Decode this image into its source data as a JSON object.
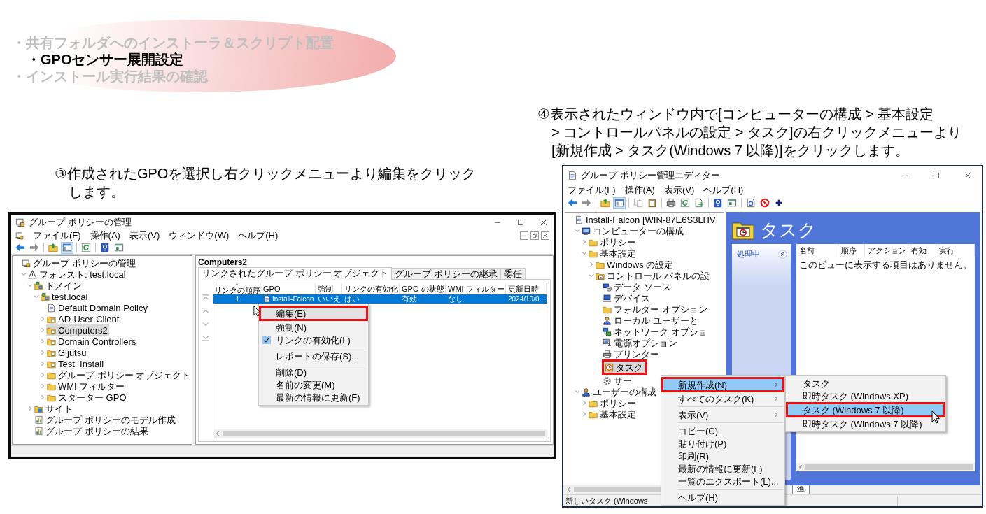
{
  "agenda": [
    {
      "label": "・共有フォルダへのインストーラ＆スクリプト配置",
      "selected": false
    },
    {
      "label": "・GPOセンサー展開設定",
      "selected": true
    },
    {
      "label": "・インストール実行結果の確認",
      "selected": false
    }
  ],
  "steps": [
    {
      "caption": [
        "③作成されたGPOを選択し右クリックメニューより編集をクリック",
        "します。"
      ],
      "window": {
        "kind": "management",
        "title": "グループ ポリシーの管理",
        "menu": [
          "ファイル(F)",
          "操作(A)",
          "表示(V)",
          "ウィンドウ(W)",
          "ヘルプ(H)"
        ],
        "toolbar": [
          [
            {
              "pressed": false,
              "disabled": false
            },
            {
              "pressed": false,
              "disabled": true
            }
          ],
          [
            {
              "pressed": false,
              "disabled": false
            },
            {
              "pressed": true,
              "disabled": false
            }
          ],
          [
            {
              "pressed": false,
              "disabled": false
            }
          ],
          [
            {
              "pressed": false,
              "disabled": false
            },
            {
              "pressed": false,
              "disabled": false
            }
          ]
        ],
        "tree": [
          {
            "label": "グループ ポリシーの管理",
            "selected": false,
            "children": [
              {
                "label": "フォレスト: test.local",
                "selected": false,
                "expanded": true,
                "children": [
                  {
                    "label": "ドメイン",
                    "selected": false,
                    "expanded": true,
                    "children": [
                      {
                        "label": "test.local",
                        "selected": false,
                        "expanded": true,
                        "children": [
                          {
                            "label": "Default Domain Policy",
                            "selected": false
                          },
                          {
                            "label": "AD-User-Client",
                            "selected": false,
                            "expanded": false
                          },
                          {
                            "label": "Computers2",
                            "selected": true,
                            "expanded": false
                          },
                          {
                            "label": "Domain Controllers",
                            "selected": false,
                            "expanded": false
                          },
                          {
                            "label": "Gijutsu",
                            "selected": false,
                            "expanded": false
                          },
                          {
                            "label": "Test_Install",
                            "selected": false,
                            "expanded": false
                          },
                          {
                            "label": "グループ ポリシー オブジェクト",
                            "selected": false,
                            "expanded": false
                          },
                          {
                            "label": "WMI フィルター",
                            "selected": false,
                            "expanded": false
                          },
                          {
                            "label": "スターター GPO",
                            "selected": false,
                            "expanded": false
                          }
                        ]
                      }
                    ]
                  },
                  {
                    "label": "サイト",
                    "selected": false,
                    "expanded": false
                  },
                  {
                    "label": "グループ ポリシーのモデル作成",
                    "selected": false
                  },
                  {
                    "label": "グループ ポリシーの結果",
                    "selected": false
                  }
                ]
              }
            ]
          }
        ],
        "detail": {
          "heading": "Computers2",
          "tabs": [
            {
              "label": "リンクされたグループ ポリシー オブジェクト",
              "selected": true
            },
            {
              "label": "グループ ポリシーの継承",
              "selected": false
            },
            {
              "label": "委任",
              "selected": false
            }
          ],
          "order_buttons": {
            "disabled": true
          },
          "columns": [
            {
              "label": "リンクの順序",
              "sorted": true
            },
            {
              "label": "GPO",
              "sorted": false
            },
            {
              "label": "強制",
              "sorted": false
            },
            {
              "label": "リンクの有効化",
              "sorted": false
            },
            {
              "label": "GPO の状態",
              "sorted": false
            },
            {
              "label": "WMI フィルター",
              "sorted": false
            },
            {
              "label": "更新日時",
              "sorted": false
            }
          ],
          "rows": [
            {
              "cells": [
                "1",
                "Install-Falcon",
                "いいえ",
                "はい",
                "有効",
                "なし",
                "2024/10/0..."
              ],
              "selected": true
            }
          ]
        },
        "context_menu": {
          "sections": [
            {
              "items": [
                {
                  "label": "編集(E)",
                  "selected": true,
                  "boxed": true,
                  "checked": false
                },
                {
                  "label": "強制(N)",
                  "selected": false,
                  "boxed": false,
                  "checked": false
                },
                {
                  "label": "リンクの有効化(L)",
                  "selected": false,
                  "boxed": false,
                  "checked": true
                }
              ]
            },
            {
              "items": [
                {
                  "label": "レポートの保存(S)...",
                  "selected": false,
                  "boxed": false,
                  "checked": false
                }
              ]
            },
            {
              "items": [
                {
                  "label": "削除(D)",
                  "selected": false,
                  "boxed": false,
                  "checked": false
                },
                {
                  "label": "名前の変更(M)",
                  "selected": false,
                  "boxed": false,
                  "checked": false
                },
                {
                  "label": "最新の情報に更新(F)",
                  "selected": false,
                  "boxed": false,
                  "checked": false
                }
              ]
            }
          ]
        }
      }
    },
    {
      "caption": [
        "④表示されたウィンドウ内で[コンピューターの構成 > 基本設定",
        "> コントロールパネルの設定 > タスク]の右クリックメニューより",
        "[新規作成 > タスク(Windows 7 以降)]をクリックします。"
      ],
      "window": {
        "kind": "editor",
        "title": "グループ ポリシー管理エディター",
        "menu": [
          "ファイル(F)",
          "操作(A)",
          "表示(V)",
          "ヘルプ(H)"
        ],
        "toolbar": [
          [
            {
              "pressed": false,
              "disabled": false
            },
            {
              "pressed": false,
              "disabled": true
            }
          ],
          [
            {
              "pressed": false,
              "disabled": false
            },
            {
              "pressed": true,
              "disabled": false
            }
          ],
          [
            {
              "pressed": false,
              "disabled": true
            },
            {
              "pressed": false,
              "disabled": false
            }
          ],
          [
            {
              "pressed": false,
              "disabled": false
            },
            {
              "pressed": false,
              "disabled": false
            },
            {
              "pressed": false,
              "disabled": false
            }
          ],
          [
            {
              "pressed": false,
              "disabled": false
            },
            {
              "pressed": false,
              "disabled": false
            }
          ],
          [
            {
              "pressed": false,
              "disabled": false
            },
            {
              "pressed": false,
              "disabled": false
            },
            {
              "pressed": false,
              "disabled": false
            }
          ]
        ],
        "tree": [
          {
            "label": "Install-Falcon [WIN-87E6S3LHV",
            "selected": false,
            "boxed": false,
            "children": [
              {
                "label": "コンピューターの構成",
                "selected": false,
                "boxed": false,
                "expanded": true,
                "children": [
                  {
                    "label": "ポリシー",
                    "selected": false,
                    "boxed": false,
                    "expanded": false
                  },
                  {
                    "label": "基本設定",
                    "selected": false,
                    "boxed": false,
                    "expanded": true,
                    "children": [
                      {
                        "label": "Windows の設定",
                        "selected": false,
                        "boxed": false,
                        "expanded": false
                      },
                      {
                        "label": "コントロール パネルの設",
                        "selected": false,
                        "boxed": false,
                        "expanded": true,
                        "children": [
                          {
                            "label": "データ ソース",
                            "selected": false,
                            "boxed": false
                          },
                          {
                            "label": "デバイス",
                            "selected": false,
                            "boxed": false
                          },
                          {
                            "label": "フォルダー オプション",
                            "selected": false,
                            "boxed": false
                          },
                          {
                            "label": "ローカル ユーザーと",
                            "selected": false,
                            "boxed": false
                          },
                          {
                            "label": "ネットワーク オプショ",
                            "selected": false,
                            "boxed": false
                          },
                          {
                            "label": "電源オプション",
                            "selected": false,
                            "boxed": false
                          },
                          {
                            "label": "プリンター",
                            "selected": false,
                            "boxed": false
                          },
                          {
                            "label": "タスク",
                            "selected": true,
                            "boxed": true
                          },
                          {
                            "label": "サー",
                            "selected": false,
                            "boxed": false
                          }
                        ]
                      }
                    ]
                  }
                ]
              },
              {
                "label": "ユーザーの構成",
                "selected": false,
                "boxed": false,
                "expanded": true,
                "children": [
                  {
                    "label": "ポリシー",
                    "selected": false,
                    "boxed": false,
                    "expanded": false
                  },
                  {
                    "label": "基本設定",
                    "selected": false,
                    "boxed": false,
                    "expanded": false
                  }
                ]
              }
            ]
          }
        ],
        "detail": {
          "title": "タスク",
          "panel_title": "処理中",
          "columns": [
            "名前",
            "順序",
            "アクション",
            "有効",
            "実行"
          ],
          "empty_message": "このビューに表示する項目はありません。"
        },
        "bottom_tabs": [
          "準"
        ],
        "status_bar": "新しいタスク (Windows",
        "context_menu": {
          "sections": [
            {
              "items": [
                {
                  "label": "新規作成(N)",
                  "selected": true,
                  "boxed": true,
                  "submenu": true
                },
                {
                  "label": "すべてのタスク(K)",
                  "selected": false,
                  "boxed": false,
                  "submenu": true
                }
              ]
            },
            {
              "items": [
                {
                  "label": "表示(V)",
                  "selected": false,
                  "boxed": false,
                  "submenu": true
                }
              ]
            },
            {
              "items": [
                {
                  "label": "コピー(C)",
                  "selected": false,
                  "boxed": false,
                  "submenu": false
                },
                {
                  "label": "貼り付け(P)",
                  "selected": false,
                  "boxed": false,
                  "submenu": false
                },
                {
                  "label": "印刷(R)",
                  "selected": false,
                  "boxed": false,
                  "submenu": false
                },
                {
                  "label": "最新の情報に更新(F)",
                  "selected": false,
                  "boxed": false,
                  "submenu": false
                },
                {
                  "label": "一覧のエクスポート(L)...",
                  "selected": false,
                  "boxed": false,
                  "submenu": false
                }
              ]
            },
            {
              "items": [
                {
                  "label": "ヘルプ(H)",
                  "selected": false,
                  "boxed": false,
                  "submenu": false
                }
              ]
            }
          ]
        },
        "submenu": {
          "items": [
            {
              "label": "タスク",
              "selected": false,
              "boxed": false
            },
            {
              "label": "即時タスク (Windows XP)",
              "selected": false,
              "boxed": false
            },
            {
              "label": "タスク (Windows 7 以降)",
              "selected": true,
              "boxed": true
            },
            {
              "label": "即時タスク (Windows 7 以降)",
              "selected": false,
              "boxed": false
            }
          ]
        }
      }
    }
  ]
}
